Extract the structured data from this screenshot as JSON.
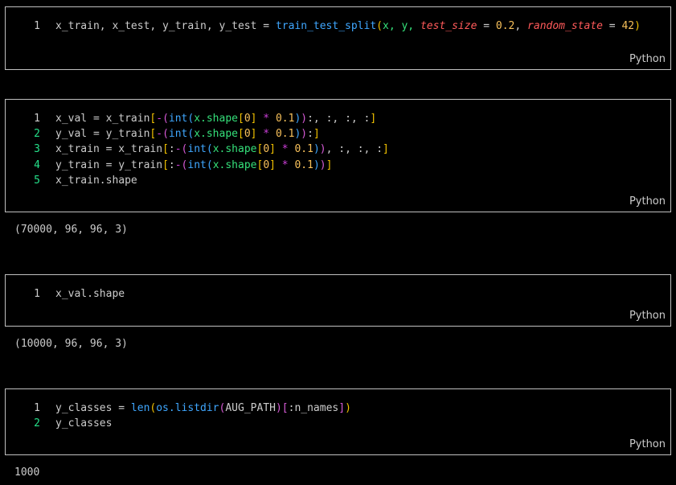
{
  "colors": {
    "background": "#000000",
    "plain": "#cccccc",
    "function": "#3fa7ff",
    "param": "#ff5a5a",
    "number": "#f7c05a",
    "bracket_gold": "#f2c200",
    "bracket_magenta": "#d65ad6",
    "bracket_blue": "#3fa7ff",
    "attr": "#35e07a",
    "operator": "#cc3fd9",
    "active_line_number": "#25e08a"
  },
  "cells": [
    {
      "language": "Python",
      "lines": [
        {
          "number": "1",
          "segments": [
            {
              "t": "x_train, x_test, y_train, y_test = ",
              "c": "plain"
            },
            {
              "t": "train_test_split",
              "c": "function"
            },
            {
              "t": "(",
              "c": "bracket_gold"
            },
            {
              "t": "x, y, ",
              "c": "attr"
            },
            {
              "t": "test_size",
              "c": "param_italic"
            },
            {
              "t": " = ",
              "c": "plain"
            },
            {
              "t": "0.2",
              "c": "number"
            },
            {
              "t": ", ",
              "c": "plain"
            },
            {
              "t": "random_state",
              "c": "param_italic"
            },
            {
              "t": " = ",
              "c": "plain"
            },
            {
              "t": "42",
              "c": "number"
            },
            {
              "t": ")",
              "c": "bracket_gold"
            }
          ]
        }
      ]
    },
    {
      "language": "Python",
      "output": "(70000, 96, 96, 3)",
      "lines": [
        {
          "number": "1",
          "segments": [
            {
              "t": "x_val = x_train",
              "c": "plain"
            },
            {
              "t": "[",
              "c": "bracket_gold"
            },
            {
              "t": "-",
              "c": "operator"
            },
            {
              "t": "(",
              "c": "bracket_magenta"
            },
            {
              "t": "int",
              "c": "function"
            },
            {
              "t": "(",
              "c": "bracket_blue"
            },
            {
              "t": "x.shape",
              "c": "attr"
            },
            {
              "t": "[",
              "c": "bracket_gold"
            },
            {
              "t": "0",
              "c": "number"
            },
            {
              "t": "]",
              "c": "bracket_gold"
            },
            {
              "t": " * ",
              "c": "operator"
            },
            {
              "t": "0.1",
              "c": "number"
            },
            {
              "t": ")",
              "c": "bracket_blue"
            },
            {
              "t": ")",
              "c": "bracket_magenta"
            },
            {
              "t": ":, :, :, :",
              "c": "plain"
            },
            {
              "t": "]",
              "c": "bracket_gold"
            }
          ]
        },
        {
          "number": "2",
          "segments": [
            {
              "t": "y_val = y_train",
              "c": "plain"
            },
            {
              "t": "[",
              "c": "bracket_gold"
            },
            {
              "t": "-",
              "c": "operator"
            },
            {
              "t": "(",
              "c": "bracket_magenta"
            },
            {
              "t": "int",
              "c": "function"
            },
            {
              "t": "(",
              "c": "bracket_blue"
            },
            {
              "t": "x.shape",
              "c": "attr"
            },
            {
              "t": "[",
              "c": "bracket_gold"
            },
            {
              "t": "0",
              "c": "number"
            },
            {
              "t": "]",
              "c": "bracket_gold"
            },
            {
              "t": " * ",
              "c": "operator"
            },
            {
              "t": "0.1",
              "c": "number"
            },
            {
              "t": ")",
              "c": "bracket_blue"
            },
            {
              "t": ")",
              "c": "bracket_magenta"
            },
            {
              "t": ":",
              "c": "plain"
            },
            {
              "t": "]",
              "c": "bracket_gold"
            }
          ]
        },
        {
          "number": "3",
          "segments": [
            {
              "t": "x_train = x_train",
              "c": "plain"
            },
            {
              "t": "[",
              "c": "bracket_gold"
            },
            {
              "t": ":",
              "c": "plain"
            },
            {
              "t": "-",
              "c": "operator"
            },
            {
              "t": "(",
              "c": "bracket_magenta"
            },
            {
              "t": "int",
              "c": "function"
            },
            {
              "t": "(",
              "c": "bracket_blue"
            },
            {
              "t": "x.shape",
              "c": "attr"
            },
            {
              "t": "[",
              "c": "bracket_gold"
            },
            {
              "t": "0",
              "c": "number"
            },
            {
              "t": "]",
              "c": "bracket_gold"
            },
            {
              "t": " * ",
              "c": "operator"
            },
            {
              "t": "0.1",
              "c": "number"
            },
            {
              "t": ")",
              "c": "bracket_blue"
            },
            {
              "t": ")",
              "c": "bracket_magenta"
            },
            {
              "t": ", :, :, :",
              "c": "plain"
            },
            {
              "t": "]",
              "c": "bracket_gold"
            }
          ]
        },
        {
          "number": "4",
          "segments": [
            {
              "t": "y_train = y_train",
              "c": "plain"
            },
            {
              "t": "[",
              "c": "bracket_gold"
            },
            {
              "t": ":",
              "c": "plain"
            },
            {
              "t": "-",
              "c": "operator"
            },
            {
              "t": "(",
              "c": "bracket_magenta"
            },
            {
              "t": "int",
              "c": "function"
            },
            {
              "t": "(",
              "c": "bracket_blue"
            },
            {
              "t": "x.shape",
              "c": "attr"
            },
            {
              "t": "[",
              "c": "bracket_gold"
            },
            {
              "t": "0",
              "c": "number"
            },
            {
              "t": "]",
              "c": "bracket_gold"
            },
            {
              "t": " * ",
              "c": "operator"
            },
            {
              "t": "0.1",
              "c": "number"
            },
            {
              "t": ")",
              "c": "bracket_blue"
            },
            {
              "t": ")",
              "c": "bracket_magenta"
            },
            {
              "t": "]",
              "c": "bracket_gold"
            }
          ]
        },
        {
          "number": "5",
          "segments": [
            {
              "t": "x_train.shape",
              "c": "plain"
            }
          ]
        }
      ]
    },
    {
      "language": "Python",
      "output": "(10000, 96, 96, 3)",
      "lines": [
        {
          "number": "1",
          "segments": [
            {
              "t": "x_val.shape",
              "c": "plain"
            }
          ]
        }
      ]
    },
    {
      "language": "Python",
      "output": "1000",
      "lines": [
        {
          "number": "1",
          "segments": [
            {
              "t": "y_classes = ",
              "c": "plain"
            },
            {
              "t": "len",
              "c": "function"
            },
            {
              "t": "(",
              "c": "bracket_gold"
            },
            {
              "t": "os.listdir",
              "c": "function"
            },
            {
              "t": "(",
              "c": "bracket_magenta"
            },
            {
              "t": "AUG_PATH",
              "c": "plain"
            },
            {
              "t": ")",
              "c": "bracket_magenta"
            },
            {
              "t": "[",
              "c": "bracket_magenta"
            },
            {
              "t": ":n_names",
              "c": "plain"
            },
            {
              "t": "]",
              "c": "bracket_magenta"
            },
            {
              "t": ")",
              "c": "bracket_gold"
            }
          ]
        },
        {
          "number": "2",
          "segments": [
            {
              "t": "y_classes",
              "c": "plain"
            }
          ]
        }
      ]
    }
  ]
}
